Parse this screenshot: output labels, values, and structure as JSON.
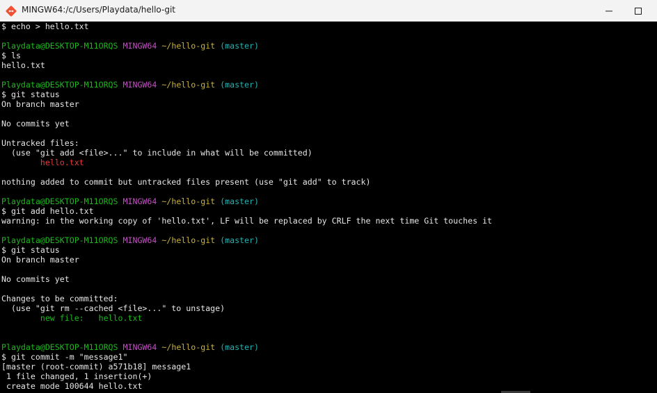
{
  "window": {
    "title": "MINGW64:/c/Users/Playdata/hello-git"
  },
  "icons": {
    "app": "git-bash-icon",
    "minimize": "minimize-icon",
    "maximize": "maximize-icon"
  },
  "colors": {
    "user": "#1cb81c",
    "shell": "#c44ec4",
    "path": "#c7b13a",
    "branch": "#24b3b3",
    "untracked": "#e33a3a",
    "staged": "#1cb81c",
    "text": "#e6e6e6",
    "background": "#000000"
  },
  "prompt": {
    "user": "Playdata@DESKTOP-M11ORQS",
    "shell": "MINGW64",
    "path": "~/hello-git",
    "branch": "(master)"
  },
  "lines": [
    {
      "type": "cmd",
      "text": "$ echo > hello.txt"
    },
    {
      "type": "blank",
      "text": ""
    },
    {
      "type": "prompt"
    },
    {
      "type": "cmd",
      "text": "$ ls"
    },
    {
      "type": "out",
      "text": "hello.txt"
    },
    {
      "type": "blank",
      "text": ""
    },
    {
      "type": "prompt"
    },
    {
      "type": "cmd",
      "text": "$ git status"
    },
    {
      "type": "out",
      "text": "On branch master"
    },
    {
      "type": "blank",
      "text": ""
    },
    {
      "type": "out",
      "text": "No commits yet"
    },
    {
      "type": "blank",
      "text": ""
    },
    {
      "type": "out",
      "text": "Untracked files:"
    },
    {
      "type": "out",
      "text": "  (use \"git add <file>...\" to include in what will be committed)"
    },
    {
      "type": "red",
      "text": "        hello.txt"
    },
    {
      "type": "blank",
      "text": ""
    },
    {
      "type": "out",
      "text": "nothing added to commit but untracked files present (use \"git add\" to track)"
    },
    {
      "type": "blank",
      "text": ""
    },
    {
      "type": "prompt"
    },
    {
      "type": "cmd",
      "text": "$ git add hello.txt"
    },
    {
      "type": "out",
      "text": "warning: in the working copy of 'hello.txt', LF will be replaced by CRLF the next time Git touches it"
    },
    {
      "type": "blank",
      "text": ""
    },
    {
      "type": "prompt"
    },
    {
      "type": "cmd",
      "text": "$ git status"
    },
    {
      "type": "out",
      "text": "On branch master"
    },
    {
      "type": "blank",
      "text": ""
    },
    {
      "type": "out",
      "text": "No commits yet"
    },
    {
      "type": "blank",
      "text": ""
    },
    {
      "type": "out",
      "text": "Changes to be committed:"
    },
    {
      "type": "out",
      "text": "  (use \"git rm --cached <file>...\" to unstage)"
    },
    {
      "type": "green",
      "text": "        new file:   hello.txt"
    },
    {
      "type": "blank",
      "text": ""
    },
    {
      "type": "blank",
      "text": ""
    },
    {
      "type": "prompt"
    },
    {
      "type": "cmd",
      "text": "$ git commit -m \"message1\""
    },
    {
      "type": "out",
      "text": "[master (root-commit) a571b18] message1"
    },
    {
      "type": "out",
      "text": " 1 file changed, 1 insertion(+)"
    },
    {
      "type": "out",
      "text": " create mode 100644 hello.txt"
    }
  ]
}
